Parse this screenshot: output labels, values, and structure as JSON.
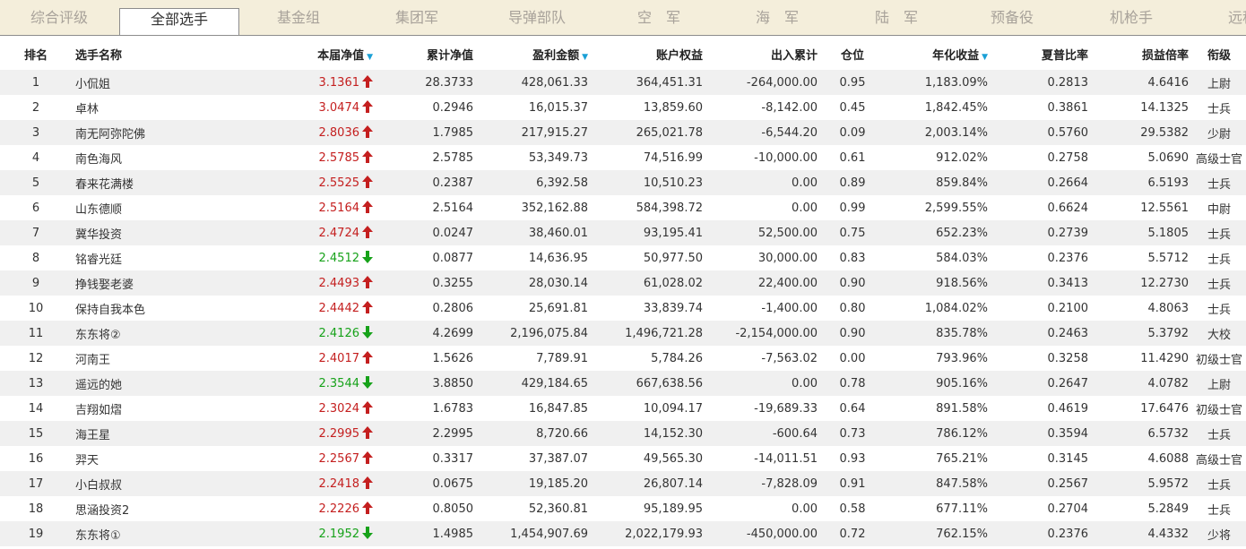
{
  "tabs": [
    "综合评级",
    "全部选手",
    "基金组",
    "集团军",
    "导弹部队",
    "空　军",
    "海　军",
    "陆　军",
    "预备役",
    "机枪手",
    "远程"
  ],
  "active_tab": 1,
  "columns": {
    "rank": "排名",
    "name": "选手名称",
    "nav": "本届净值",
    "cum_nav": "累计净值",
    "profit": "盈利金额",
    "equity": "账户权益",
    "inout": "出入累计",
    "position": "仓位",
    "annual": "年化收益",
    "sharpe": "夏普比率",
    "pl_ratio": "损益倍率",
    "title": "衔级"
  },
  "colors": {
    "up": "#c41f1f",
    "down": "#17a21a",
    "sort_icon": "#1aa0d6",
    "tabbar_bg": "#f4eedb"
  },
  "rows": [
    {
      "rank": "1",
      "name": "小侃姐",
      "nav": "3.1361",
      "dir": "up",
      "cum_nav": "28.3733",
      "profit": "428,061.33",
      "equity": "364,451.31",
      "inout": "-264,000.00",
      "position": "0.95",
      "annual": "1,183.09%",
      "sharpe": "0.2813",
      "pl_ratio": "4.6416",
      "title": "上尉"
    },
    {
      "rank": "2",
      "name": "卓林",
      "nav": "3.0474",
      "dir": "up",
      "cum_nav": "0.2946",
      "profit": "16,015.37",
      "equity": "13,859.60",
      "inout": "-8,142.00",
      "position": "0.45",
      "annual": "1,842.45%",
      "sharpe": "0.3861",
      "pl_ratio": "14.1325",
      "title": "士兵"
    },
    {
      "rank": "3",
      "name": "南无阿弥陀佛",
      "nav": "2.8036",
      "dir": "up",
      "cum_nav": "1.7985",
      "profit": "217,915.27",
      "equity": "265,021.78",
      "inout": "-6,544.20",
      "position": "0.09",
      "annual": "2,003.14%",
      "sharpe": "0.5760",
      "pl_ratio": "29.5382",
      "title": "少尉"
    },
    {
      "rank": "4",
      "name": "南色海风",
      "nav": "2.5785",
      "dir": "up",
      "cum_nav": "2.5785",
      "profit": "53,349.73",
      "equity": "74,516.99",
      "inout": "-10,000.00",
      "position": "0.61",
      "annual": "912.02%",
      "sharpe": "0.2758",
      "pl_ratio": "5.0690",
      "title": "高级士官"
    },
    {
      "rank": "5",
      "name": "春来花满楼",
      "nav": "2.5525",
      "dir": "up",
      "cum_nav": "0.2387",
      "profit": "6,392.58",
      "equity": "10,510.23",
      "inout": "0.00",
      "position": "0.89",
      "annual": "859.84%",
      "sharpe": "0.2664",
      "pl_ratio": "6.5193",
      "title": "士兵"
    },
    {
      "rank": "6",
      "name": "山东德顺",
      "nav": "2.5164",
      "dir": "up",
      "cum_nav": "2.5164",
      "profit": "352,162.88",
      "equity": "584,398.72",
      "inout": "0.00",
      "position": "0.99",
      "annual": "2,599.55%",
      "sharpe": "0.6624",
      "pl_ratio": "12.5561",
      "title": "中尉"
    },
    {
      "rank": "7",
      "name": "冀华投资",
      "nav": "2.4724",
      "dir": "up",
      "cum_nav": "0.0247",
      "profit": "38,460.01",
      "equity": "93,195.41",
      "inout": "52,500.00",
      "position": "0.75",
      "annual": "652.23%",
      "sharpe": "0.2739",
      "pl_ratio": "5.1805",
      "title": "士兵"
    },
    {
      "rank": "8",
      "name": "铭睿光廷",
      "nav": "2.4512",
      "dir": "down",
      "cum_nav": "0.0877",
      "profit": "14,636.95",
      "equity": "50,977.50",
      "inout": "30,000.00",
      "position": "0.83",
      "annual": "584.03%",
      "sharpe": "0.2376",
      "pl_ratio": "5.5712",
      "title": "士兵"
    },
    {
      "rank": "9",
      "name": "挣钱娶老婆",
      "nav": "2.4493",
      "dir": "up",
      "cum_nav": "0.3255",
      "profit": "28,030.14",
      "equity": "61,028.02",
      "inout": "22,400.00",
      "position": "0.90",
      "annual": "918.56%",
      "sharpe": "0.3413",
      "pl_ratio": "12.2730",
      "title": "士兵"
    },
    {
      "rank": "10",
      "name": "保持自我本色",
      "nav": "2.4442",
      "dir": "up",
      "cum_nav": "0.2806",
      "profit": "25,691.81",
      "equity": "33,839.74",
      "inout": "-1,400.00",
      "position": "0.80",
      "annual": "1,084.02%",
      "sharpe": "0.2100",
      "pl_ratio": "4.8063",
      "title": "士兵"
    },
    {
      "rank": "11",
      "name": "东东将②",
      "nav": "2.4126",
      "dir": "down",
      "cum_nav": "4.2699",
      "profit": "2,196,075.84",
      "equity": "1,496,721.28",
      "inout": "-2,154,000.00",
      "position": "0.90",
      "annual": "835.78%",
      "sharpe": "0.2463",
      "pl_ratio": "5.3792",
      "title": "大校"
    },
    {
      "rank": "12",
      "name": "河南王",
      "nav": "2.4017",
      "dir": "up",
      "cum_nav": "1.5626",
      "profit": "7,789.91",
      "equity": "5,784.26",
      "inout": "-7,563.02",
      "position": "0.00",
      "annual": "793.96%",
      "sharpe": "0.3258",
      "pl_ratio": "11.4290",
      "title": "初级士官"
    },
    {
      "rank": "13",
      "name": "遥远的她",
      "nav": "2.3544",
      "dir": "down",
      "cum_nav": "3.8850",
      "profit": "429,184.65",
      "equity": "667,638.56",
      "inout": "0.00",
      "position": "0.78",
      "annual": "905.16%",
      "sharpe": "0.2647",
      "pl_ratio": "4.0782",
      "title": "上尉"
    },
    {
      "rank": "14",
      "name": "吉翔如熠",
      "nav": "2.3024",
      "dir": "up",
      "cum_nav": "1.6783",
      "profit": "16,847.85",
      "equity": "10,094.17",
      "inout": "-19,689.33",
      "position": "0.64",
      "annual": "891.58%",
      "sharpe": "0.4619",
      "pl_ratio": "17.6476",
      "title": "初级士官"
    },
    {
      "rank": "15",
      "name": "海王星",
      "nav": "2.2995",
      "dir": "up",
      "cum_nav": "2.2995",
      "profit": "8,720.66",
      "equity": "14,152.30",
      "inout": "-600.64",
      "position": "0.73",
      "annual": "786.12%",
      "sharpe": "0.3594",
      "pl_ratio": "6.5732",
      "title": "士兵"
    },
    {
      "rank": "16",
      "name": "羿天",
      "nav": "2.2567",
      "dir": "up",
      "cum_nav": "0.3317",
      "profit": "37,387.07",
      "equity": "49,565.30",
      "inout": "-14,011.51",
      "position": "0.93",
      "annual": "765.21%",
      "sharpe": "0.3145",
      "pl_ratio": "4.6088",
      "title": "高级士官"
    },
    {
      "rank": "17",
      "name": "小白叔叔",
      "nav": "2.2418",
      "dir": "up",
      "cum_nav": "0.0675",
      "profit": "19,185.20",
      "equity": "26,807.14",
      "inout": "-7,828.09",
      "position": "0.91",
      "annual": "847.58%",
      "sharpe": "0.2567",
      "pl_ratio": "5.9572",
      "title": "士兵"
    },
    {
      "rank": "18",
      "name": "思涵投资2",
      "nav": "2.2226",
      "dir": "up",
      "cum_nav": "0.8050",
      "profit": "52,360.81",
      "equity": "95,189.95",
      "inout": "0.00",
      "position": "0.58",
      "annual": "677.11%",
      "sharpe": "0.2704",
      "pl_ratio": "5.2849",
      "title": "士兵"
    },
    {
      "rank": "19",
      "name": "东东将①",
      "nav": "2.1952",
      "dir": "down",
      "cum_nav": "1.4985",
      "profit": "1,454,907.69",
      "equity": "2,022,179.93",
      "inout": "-450,000.00",
      "position": "0.72",
      "annual": "762.15%",
      "sharpe": "0.2376",
      "pl_ratio": "4.4332",
      "title": "少将"
    }
  ]
}
